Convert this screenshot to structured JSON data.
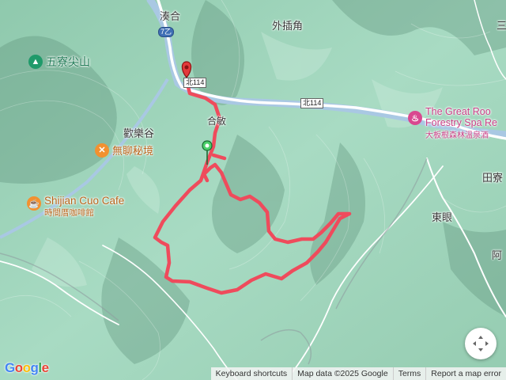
{
  "places": {
    "couhe": "湊合",
    "waichajiao": "外插角",
    "wuliaojian": "五寮尖山",
    "huanlegu": "歡樂谷",
    "hemin": "合敏",
    "tianliao": "田寮",
    "dongyan": "東眼",
    "agong": "阿",
    "sanjing": "三"
  },
  "pois": {
    "boring": "無聊秘境",
    "shijian_en": "Shijian Cuo Cafe",
    "shijian_zh": "時間厝咖啡館",
    "greatroots_line1": "The Great Roo",
    "greatroots_line2": "Forestry Spa Re",
    "greatroots_zh": "大板根森林溫泉酒"
  },
  "roads": {
    "r7b": "7乙",
    "north114_a": "北114",
    "north114_b": "北114"
  },
  "trail_labels": {
    "start_marker": "start-pin",
    "end_marker": "end-pin"
  },
  "footer": {
    "keyboard": "Keyboard shortcuts",
    "mapdata": "Map data ©2025 Google",
    "terms": "Terms",
    "report": "Report a map error"
  },
  "logo": "Google",
  "colors": {
    "terrain": "#a6d9c2",
    "track": "#ef4b5c",
    "poi_orange": "#f29130",
    "poi_green": "#1f9a6a",
    "poi_pink": "#d9488f"
  }
}
